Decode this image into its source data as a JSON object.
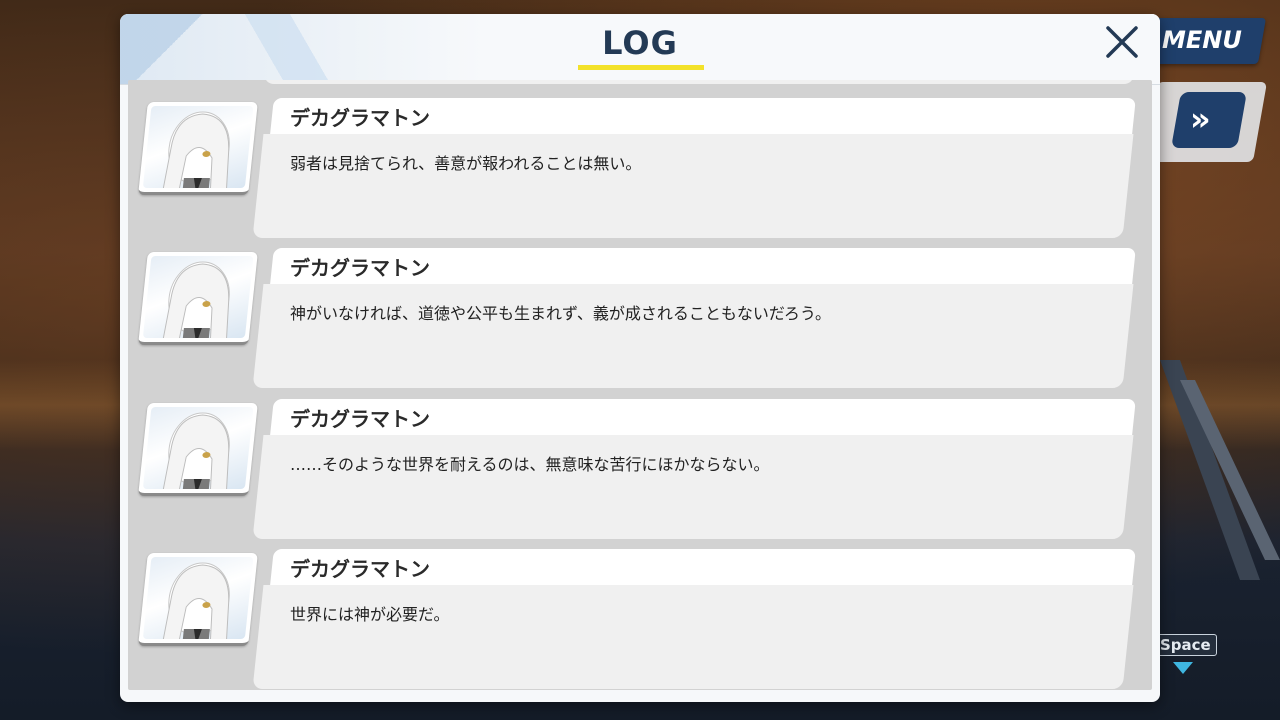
{
  "hud": {
    "menu_label": "MENU",
    "fast_forward_glyph": "»",
    "space_key_label": "Space"
  },
  "dialog": {
    "title": "LOG",
    "close_icon": "close-icon"
  },
  "log": [
    {
      "speaker": "デカグラマトン",
      "text": "弱者は見捨てられ、善意が報われることは無い。",
      "portrait": "white-haired-character-avatar"
    },
    {
      "speaker": "デカグラマトン",
      "text": "神がいなければ、道徳や公平も生まれず、義が成されることもないだろう。",
      "portrait": "white-haired-character-avatar"
    },
    {
      "speaker": "デカグラマトン",
      "text": "……そのような世界を耐えるのは、無意味な苦行にほかならない。",
      "portrait": "white-haired-character-avatar"
    },
    {
      "speaker": "デカグラマトン",
      "text": "世界には神が必要だ。",
      "portrait": "white-haired-character-avatar"
    }
  ],
  "colors": {
    "accent_yellow": "#f3e22a",
    "title_navy": "#233a55",
    "hud_navy": "#1f3f6b"
  }
}
